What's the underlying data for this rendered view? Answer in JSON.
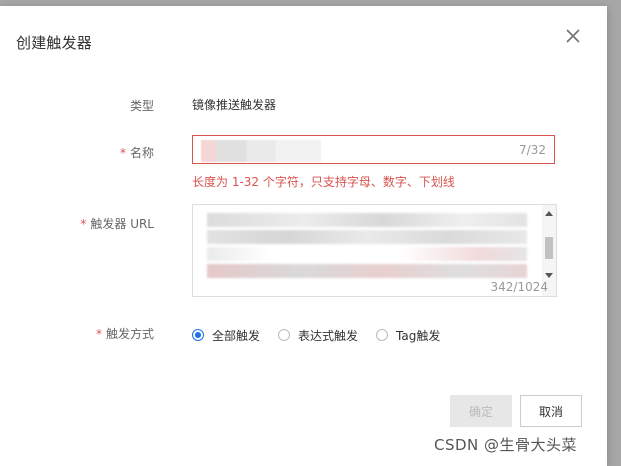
{
  "dialog": {
    "title": "创建触发器",
    "close_icon": "close-icon"
  },
  "fields": {
    "type": {
      "label": "类型",
      "value": "镜像推送触发器"
    },
    "name": {
      "required_mark": "*",
      "label": "名称",
      "counter": "7/32",
      "error": "长度为 1-32 个字符，只支持字母、数字、下划线"
    },
    "url": {
      "required_mark": "*",
      "label": "触发器 URL",
      "counter": "342/1024"
    },
    "method": {
      "required_mark": "*",
      "label": "触发方式",
      "options": [
        "全部触发",
        "表达式触发",
        "Tag触发"
      ],
      "selected": "全部触发"
    }
  },
  "buttons": {
    "confirm": "确定",
    "cancel": "取消"
  },
  "watermark": "CSDN @生骨大头菜",
  "colors": {
    "accent": "#1a73e8",
    "error": "#d9534f"
  }
}
